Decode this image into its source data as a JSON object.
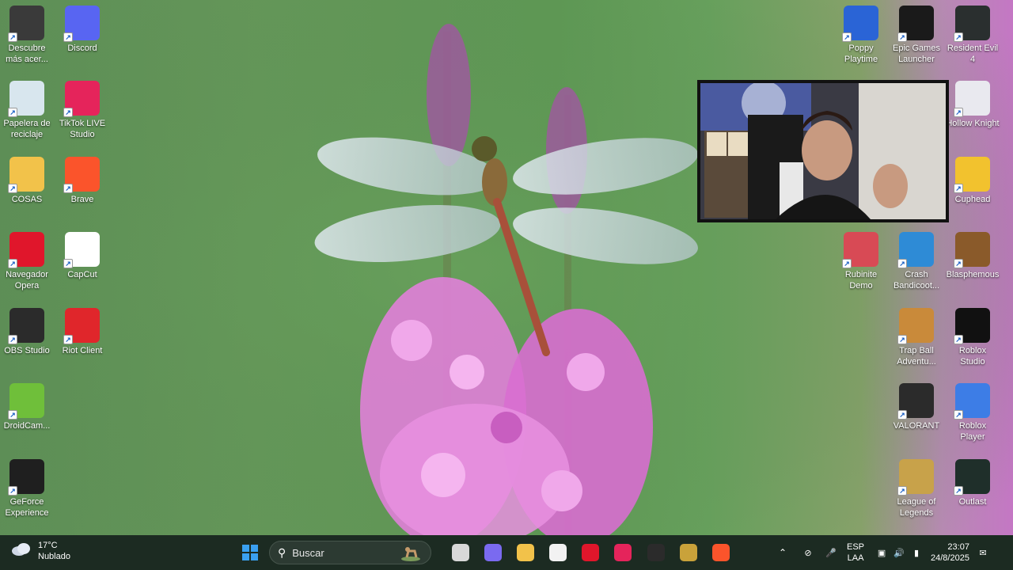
{
  "desktop": {
    "left_icons": [
      {
        "label": "Descubre más acer...",
        "icon": "acer-discover-icon",
        "color": "#3a3a3a"
      },
      {
        "label": "Discord",
        "icon": "discord-icon",
        "color": "#5865f2"
      },
      {
        "label": "Papelera de reciclaje",
        "icon": "recycle-bin-icon",
        "color": "#d8e6ee"
      },
      {
        "label": "TikTok LIVE Studio",
        "icon": "tiktok-live-icon",
        "color": "#e5245b"
      },
      {
        "label": "COSAS",
        "icon": "folder-icon",
        "color": "#f2c24a"
      },
      {
        "label": "Brave",
        "icon": "brave-icon",
        "color": "#fb542b"
      },
      {
        "label": "Navegador Opera",
        "icon": "opera-icon",
        "color": "#e0162b"
      },
      {
        "label": "CapCut",
        "icon": "capcut-icon",
        "color": "#ffffff"
      },
      {
        "label": "OBS Studio",
        "icon": "obs-icon",
        "color": "#2b2b2b"
      },
      {
        "label": "Riot Client",
        "icon": "riot-client-icon",
        "color": "#e0262b"
      },
      {
        "label": "DroidCam...",
        "icon": "droidcam-icon",
        "color": "#6fbf3a"
      },
      {
        "label": "GeForce Experience",
        "icon": "geforce-icon",
        "color": "#1f1f1f"
      }
    ],
    "right_icons": [
      {
        "label": "Poppy Playtime",
        "icon": "poppy-playtime-icon",
        "color": "#2a64d6"
      },
      {
        "label": "Epic Games Launcher",
        "icon": "epic-games-icon",
        "color": "#1a1a1a"
      },
      {
        "label": "Resident Evil 4",
        "icon": "resident-evil-icon",
        "color": "#2a2f2f"
      },
      {
        "label": "Hollow Knight",
        "icon": "hollow-knight-icon",
        "color": "#e9e9ef"
      },
      {
        "label": "Cuphead",
        "icon": "cuphead-icon",
        "color": "#f2c22e"
      },
      {
        "label": "Rubinite Demo",
        "icon": "rubinite-icon",
        "color": "#d84a55"
      },
      {
        "label": "Crash Bandicoot...",
        "icon": "crash-bandicoot-icon",
        "color": "#2e8bd6"
      },
      {
        "label": "Blasphemous",
        "icon": "blasphemous-icon",
        "color": "#8a5a2a"
      },
      {
        "label": "Trap Ball Adventu...",
        "icon": "trap-ball-icon",
        "color": "#c98a3a"
      },
      {
        "label": "Roblox Studio",
        "icon": "roblox-studio-icon",
        "color": "#111111"
      },
      {
        "label": "VALORANT",
        "icon": "valorant-icon",
        "color": "#2b2b2b"
      },
      {
        "label": "Roblox Player",
        "icon": "roblox-player-icon",
        "color": "#3d7de6"
      },
      {
        "label": "League of Legends",
        "icon": "league-of-legends-icon",
        "color": "#c8a24a"
      },
      {
        "label": "Outlast",
        "icon": "outlast-icon",
        "color": "#1f2f2a"
      }
    ]
  },
  "taskbar": {
    "weather": {
      "temp": "17°C",
      "condition": "Nublado"
    },
    "search": {
      "placeholder": "Buscar"
    },
    "apps": [
      {
        "name": "windows-start-icon",
        "color": "#3aa0f0"
      },
      {
        "name": "task-view-icon",
        "color": "#d8d8d8"
      },
      {
        "name": "copilot-icon",
        "color": "#7a6af0"
      },
      {
        "name": "file-explorer-icon",
        "color": "#f2c24a"
      },
      {
        "name": "microsoft-store-icon",
        "color": "#f2f2f2"
      },
      {
        "name": "opera-icon",
        "color": "#e0162b"
      },
      {
        "name": "tiktok-live-icon",
        "color": "#e5245b"
      },
      {
        "name": "obs-icon",
        "color": "#2b2b2b"
      },
      {
        "name": "game-app-icon",
        "color": "#c9a23a"
      },
      {
        "name": "brave-icon",
        "color": "#fb542b"
      }
    ],
    "tray": {
      "lang_top": "ESP",
      "lang_bottom": "LAA",
      "time": "23:07",
      "date": "24/8/2025"
    }
  }
}
